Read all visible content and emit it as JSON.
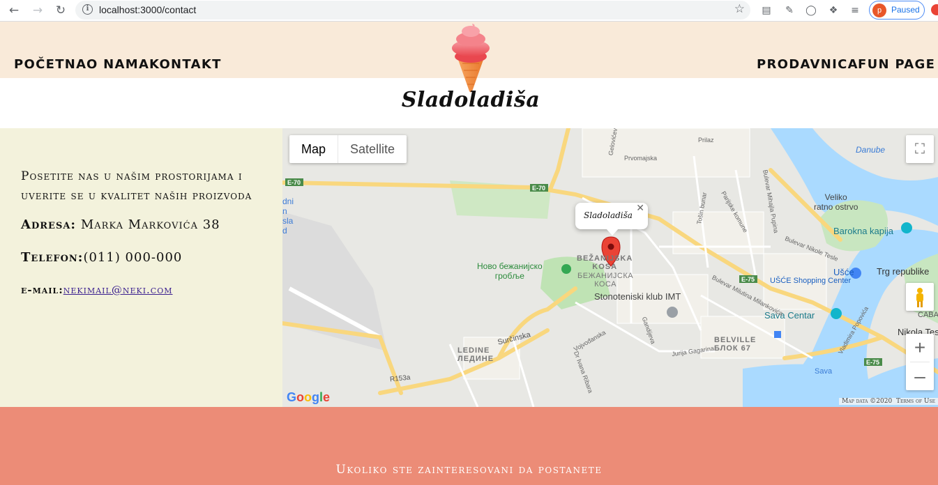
{
  "browser": {
    "url": "localhost:3000/contact",
    "profile_initial": "p",
    "profile_status": "Paused"
  },
  "nav": {
    "left": [
      "Početna",
      "O nama",
      "Kontakt"
    ],
    "right": [
      "Prodavnica",
      "Fun page"
    ]
  },
  "brand": {
    "name": "Sladoladiša"
  },
  "contact": {
    "intro": "Posetite nas u našim prostorijama i uverite se u kvalitet naših proizvoda",
    "address_label": "Adresa:",
    "address_value": "Marka Markovića 38",
    "phone_label": "Telefon:",
    "phone_value": "(011) 000-000",
    "email_label": "e-mail:",
    "email_value": "nekimail@neki.com"
  },
  "map": {
    "type_map": "Map",
    "type_satellite": "Satellite",
    "marker_title": "Sladoladiša",
    "attribution_data": "Map data ©2020",
    "attribution_terms": "Terms of Use",
    "google": "Google",
    "labels": {
      "danube": "Danube",
      "veliko": "Veliko\nratno ostrvo",
      "barokna": "Barokna kapija",
      "trg": "Trg republike",
      "usce": "Ušće",
      "usce_sc": "UŠĆE Shopping Center",
      "bezanijska_lat": "BEŽANIJSKA\nKOSA",
      "bezanijska_cyr": "БЕЖАНИЈСКА\nКОСА",
      "groblje": "Ново бежанијско\nгробље",
      "imt": "Stonoteniski klub IMT",
      "sava_center": "Sava Centar",
      "belville": "BELVILLE\nБЛОК 67",
      "ledine": "LEDINE\nЛЕДИНЕ",
      "nikola_tesla": "Nikola Tesl",
      "caba": "CABA",
      "sava": "Sava",
      "surcinska": "Surčinska",
      "r153a": "R153a",
      "e70_a": "E-70",
      "e70_b": "E-70",
      "e75_a": "E-75",
      "e75_b": "E-75",
      "dni": "dni\nn\nsla\nd",
      "prvomajska": "Prvomajska",
      "prilaz": "Prilaz",
      "gandijeva": "Gandijeva",
      "jurija": "Jurija Gagarina",
      "vojvodjanska": "Vojvođanska",
      "partizanske": "Parijske komune",
      "tosin": "Tošin bunar",
      "mihajla": "Bulevar Mihajla Pupina",
      "milutina": "Bulevar Milutina Milankovića",
      "zorana": "Bulevar Nikole Tesle",
      "popovica": "Vladimira Popovića",
      "ivana": "Dr Ivana Ribara",
      "gelovic": "Gelovićeva"
    }
  },
  "footer": {
    "text": "Ukoliko ste zainteresovani da postanete"
  }
}
